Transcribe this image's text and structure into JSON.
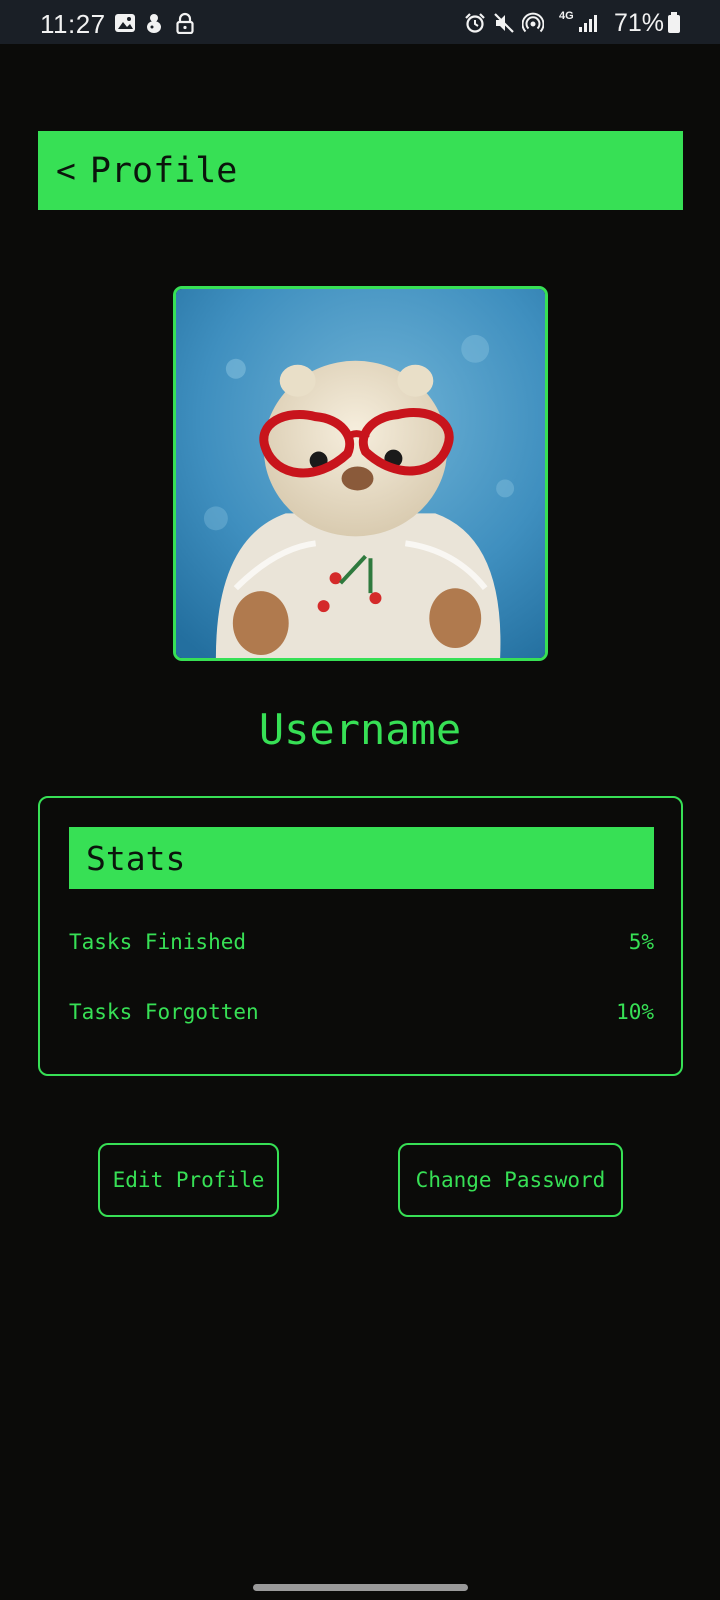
{
  "status_bar": {
    "time": "11:27",
    "network": "4G",
    "battery": "71%"
  },
  "header": {
    "back_label": "<",
    "title": "Profile"
  },
  "profile": {
    "username": "Username"
  },
  "stats": {
    "title": "Stats",
    "rows": [
      {
        "label": "Tasks Finished",
        "value": "5%"
      },
      {
        "label": "Tasks Forgotten",
        "value": "10%"
      }
    ]
  },
  "actions": {
    "edit_label": "Edit Profile",
    "password_label": "Change Password"
  },
  "colors": {
    "accent": "#37e055",
    "background": "#0b0b09",
    "status_bar": "#1a1f26"
  }
}
